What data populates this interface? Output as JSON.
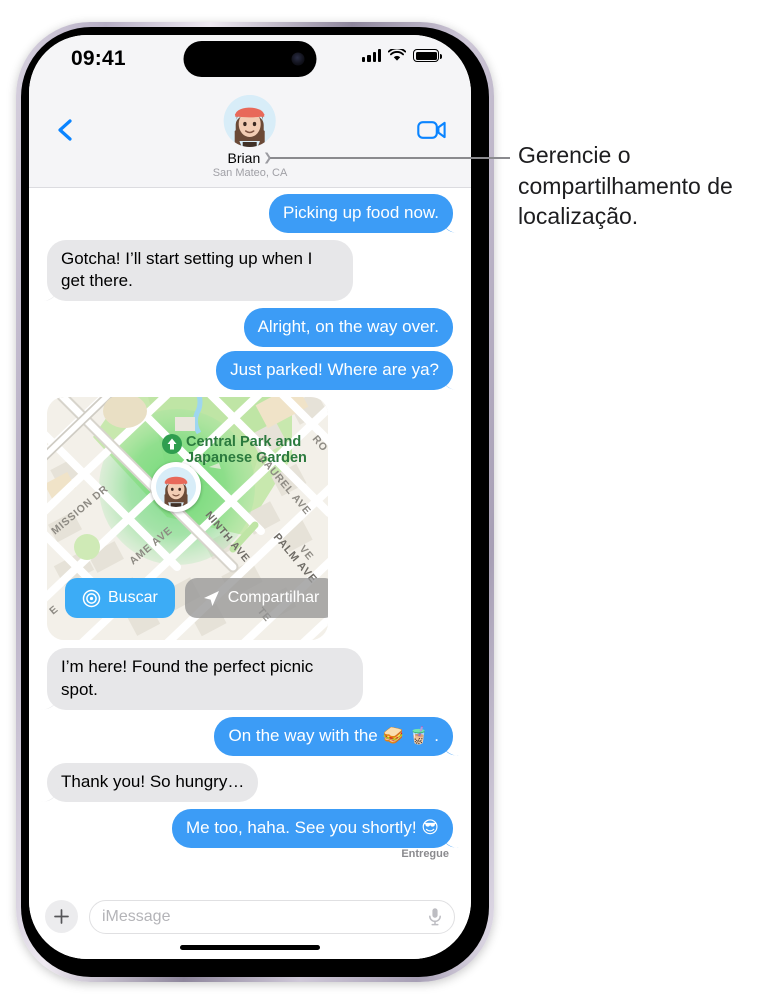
{
  "status_bar": {
    "time": "09:41",
    "icons": [
      "cellular-signal-icon",
      "wifi-icon",
      "battery-icon"
    ]
  },
  "header": {
    "back_icon": "back-chevron-icon",
    "facetime_icon": "video-camera-icon",
    "avatar_icon": "memoji-avatar",
    "contact_name": "Brian",
    "disclosure_icon": "chevron-right-icon",
    "location_subtitle": "San Mateo, CA"
  },
  "messages": [
    {
      "side": "out",
      "text": "Picking up food now.",
      "tail": true
    },
    {
      "side": "in",
      "text": "Gotcha! I’ll start setting up when I get there.",
      "tail": true
    },
    {
      "side": "out",
      "text": "Alright, on the way over.",
      "tail": false
    },
    {
      "side": "out",
      "text": "Just parked! Where are ya?",
      "tail": true
    },
    {
      "side": "in",
      "text": "I’m here! Found the perfect picnic spot.",
      "tail": true
    },
    {
      "side": "out",
      "text": "On the way with the 🥪 🧋 .",
      "tail": true
    },
    {
      "side": "in",
      "text": "Thank you! So hungry…",
      "tail": true
    },
    {
      "side": "out",
      "text": "Me too, haha. See you shortly! 😎",
      "tail": true
    }
  ],
  "delivery_status": "Entregue",
  "map": {
    "park_label": "Central Park and Japanese Garden",
    "park_icon": "tree-marker-icon",
    "streets": [
      "MISSION DR",
      "NINTH AVE",
      "LAUREL AVE",
      "PALM AVE",
      "PALM AVE",
      "AME AVE",
      "RO",
      "TE"
    ],
    "pin_icon": "memoji-location-pin",
    "find_button": {
      "label": "Buscar",
      "icon": "radar-target-icon",
      "color": "#3cacf6"
    },
    "share_button": {
      "label": "Compartilhar",
      "icon": "navigation-arrow-icon",
      "color": "#969696"
    }
  },
  "input_bar": {
    "plus_icon": "plus-icon",
    "placeholder": "iMessage",
    "mic_icon": "microphone-icon"
  },
  "callout": {
    "text": "Gerencie o compartilhamento de localização."
  },
  "colors": {
    "outgoing_bubble": "#3c9cf6",
    "incoming_bubble": "#e7e7e9",
    "header_background": "#f5f5f7",
    "accent_blue": "#0a84ff"
  }
}
